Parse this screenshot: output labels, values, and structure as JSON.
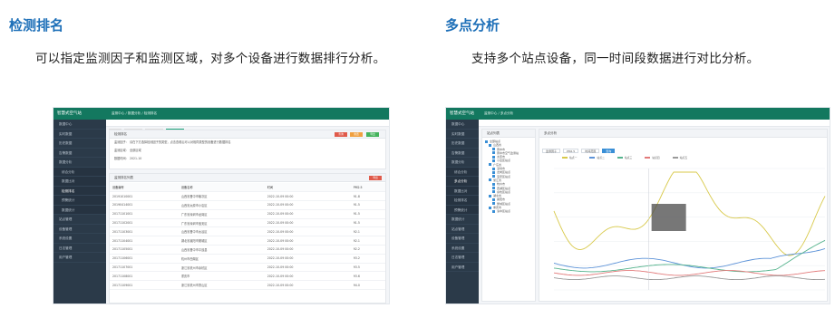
{
  "features": [
    {
      "title": "检测排名",
      "desc": "可以指定监测因子和监测区域，对多个设备进行数据排行分析。",
      "screenshot": {
        "app_title": "智慧式空气站",
        "breadcrumb": "监测中心 / 数据分析 / 检测排名",
        "tabs": [
          "首页",
          "实时数据",
          "历史数据",
          "检测排名"
        ],
        "sidebar": [
          "数据中心",
          "实时数据",
          "历史数据",
          "告警数据",
          "数据分析",
          "综合分析",
          "数据比对",
          "检测排名",
          "预警统计",
          "数据统计",
          "站点管理",
          "设备管理",
          "系统设置",
          "日志管理",
          "用户管理"
        ],
        "filter_title": "检测排名",
        "filter_rows": [
          "监测因子： 请在下方选择检测因子的类型，点击查看后可以对相同类型的设备进行数据排名",
          "监测区域： 全部区域",
          "数据时间： 2021-10"
        ],
        "filter_buttons": [
          "查询",
          "重置",
          "导出"
        ],
        "list_title": "监测排名列表",
        "table_header": [
          "设备编号",
          "设备名称",
          "时间",
          "PM2.5"
        ],
        "table_rows": [
          [
            "20191010001",
            "山西省晋中市榆次区",
            "2022-10-09 00:00",
            "91.8"
          ],
          [
            "20190414001",
            "山西省太原市小店区",
            "2022-10-09 00:00",
            "91.5"
          ],
          [
            "20171101001",
            "广东省深圳市龙岗区",
            "2022-10-09 00:00",
            "91.5"
          ],
          [
            "20171102001",
            "广东省深圳市宝安区",
            "2022-10-09 00:00",
            "91.5"
          ],
          [
            "20171103001",
            "山西省晋中市太谷区",
            "2022-10-09 00:00",
            "92.1"
          ],
          [
            "20171104001",
            "湖北省襄阳市樊城区",
            "2022-10-09 00:00",
            "92.1"
          ],
          [
            "20171105001",
            "山西省晋中市平遥县",
            "2022-10-09 00:00",
            "92.2"
          ],
          [
            "20171106001",
            "杭州市西湖区",
            "2022-10-09 00:00",
            "93.2"
          ],
          [
            "20171107001",
            "浙江省杭州市余杭区",
            "2022-10-09 00:00",
            "93.5"
          ],
          [
            "20171108001",
            "重庆市",
            "2022-10-09 00:00",
            "93.6"
          ],
          [
            "20171109001",
            "浙江省杭州市萧山区",
            "2022-10-09 00:00",
            "94.0"
          ]
        ],
        "export_button": "导出"
      }
    },
    {
      "title": "多点分析",
      "desc": "支持多个站点设备，同一时间段数据进行对比分析。",
      "screenshot": {
        "app_title": "智慧式空气站",
        "breadcrumb": "监测中心 / 多点分析",
        "tabs": [
          "首页",
          "多点分析"
        ],
        "sidebar": [
          "数据中心",
          "实时数据",
          "历史数据",
          "告警数据",
          "数据分析",
          "综合分析",
          "多点分析",
          "数据比对",
          "检测排名",
          "预警统计",
          "数据统计",
          "站点管理",
          "设备管理",
          "系统设置",
          "日志管理",
          "用户管理"
        ],
        "tree_title": "站点列表",
        "tree_items": [
          "全部站点",
          "山西省",
          "晋中市",
          "晋中市空气监测站",
          "太原市",
          "小店区站点",
          "广东省",
          "深圳市",
          "龙岗区站点",
          "宝安区站点",
          "浙江省",
          "杭州市",
          "西湖区站点",
          "余杭区站点",
          "湖北省",
          "襄阳市",
          "樊城区站点",
          "重庆市",
          "渝中区站点"
        ],
        "chart_title": "多点分析",
        "chart_controls": [
          "监测因子",
          "PM2.5",
          "时间范围",
          "查询"
        ],
        "legend": [
          "站点一",
          "站点二",
          "站点三",
          "站点四",
          "站点五"
        ],
        "series_colors": [
          "#d8c94a",
          "#5d93d8",
          "#55b38d",
          "#e27a7a",
          "#9a9a9a"
        ]
      }
    }
  ]
}
